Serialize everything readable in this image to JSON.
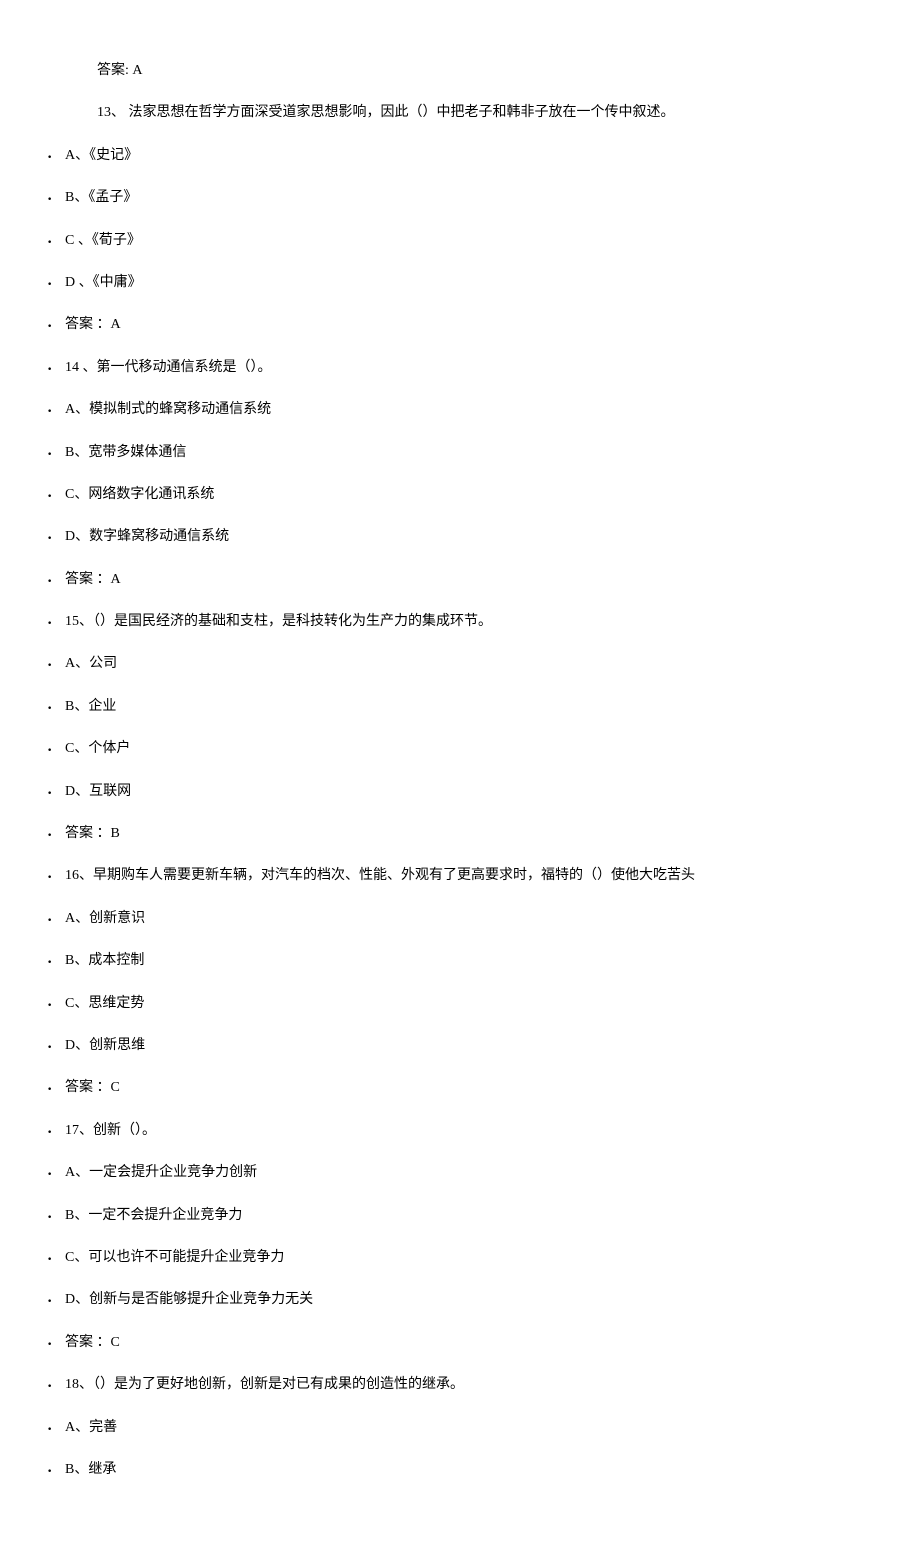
{
  "intro": {
    "answer_12": "答案: A",
    "question_13": "13、 法家思想在哲学方面深受道家思想影响，因此（）中把老子和韩非子放在一个传中叙述。"
  },
  "items": [
    {
      "text": "A、《史记》"
    },
    {
      "text": "B、《孟子》"
    },
    {
      "text": "  C 、《荀子》"
    },
    {
      "text": "  D 、《中庸》"
    },
    {
      "text": "  答案 ：A"
    },
    {
      "text": "  14 、第一代移动通信系统是（）。"
    },
    {
      "text": "A、模拟制式的蜂窝移动通信系统"
    },
    {
      "text": "B、宽带多媒体通信"
    },
    {
      "text": "C、网络数字化通讯系统"
    },
    {
      "text": "D、数字蜂窝移动通信系统"
    },
    {
      "text": "  答案 ：A"
    },
    {
      "text": "  15、（）是国民经济的基础和支柱，是科技转化为生产力的集成环节。"
    },
    {
      "text": "A、公司"
    },
    {
      "text": "B、企业"
    },
    {
      "text": "C、个体户"
    },
    {
      "text": "D、互联网"
    },
    {
      "text": "  答案 ：B"
    },
    {
      "text": "  16、早期购车人需要更新车辆，对汽车的档次、性能、外观有了更高要求时，福特的（）使他大吃苦头"
    },
    {
      "text": "A、创新意识"
    },
    {
      "text": "B、成本控制"
    },
    {
      "text": "C、思维定势"
    },
    {
      "text": "D、创新思维"
    },
    {
      "text": "  答案 ：C"
    },
    {
      "text": "  17、创新（）。"
    },
    {
      "text": "A、一定会提升企业竞争力创新"
    },
    {
      "text": "B、一定不会提升企业竞争力"
    },
    {
      "text": "C、可以也许不可能提升企业竞争力"
    },
    {
      "text": "D、创新与是否能够提升企业竞争力无关"
    },
    {
      "text": "  答案 ：C"
    },
    {
      "text": "  18、（）是为了更好地创新，创新是对已有成果的创造性的继承。"
    },
    {
      "text": " A、完善"
    },
    {
      "text": "B、继承"
    }
  ]
}
